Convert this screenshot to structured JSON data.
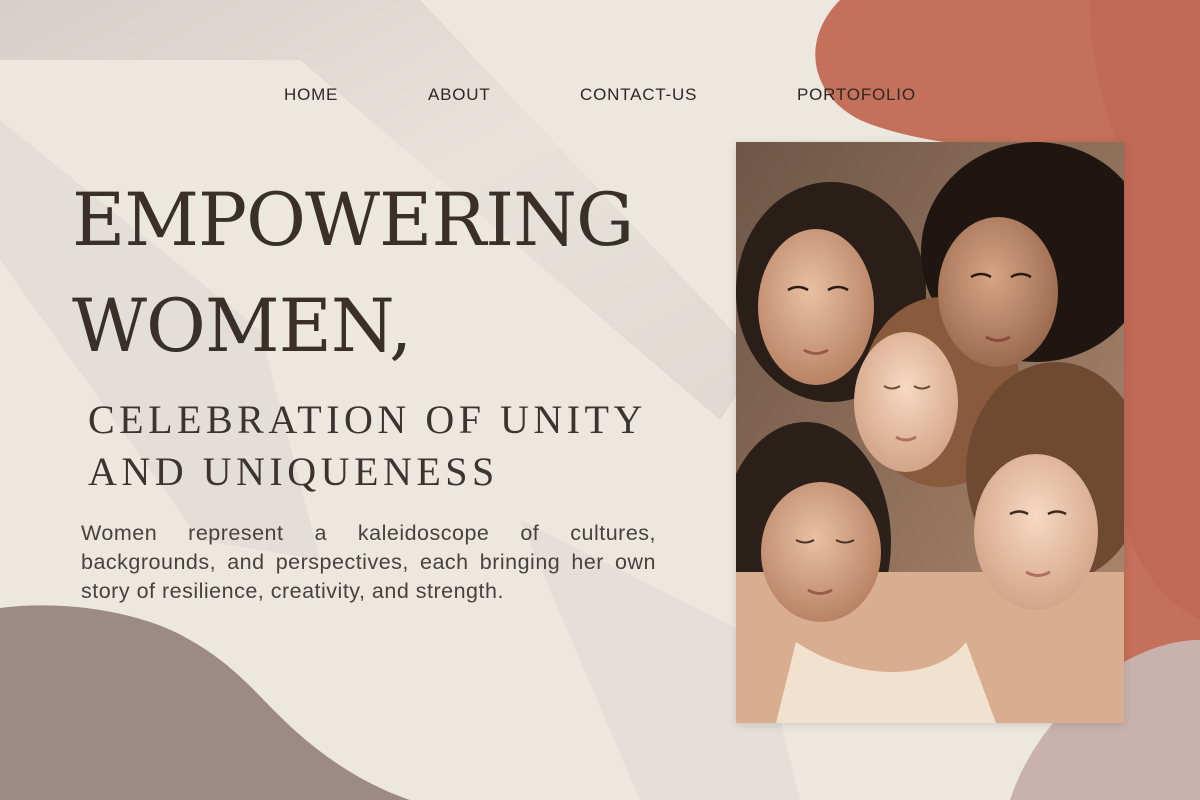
{
  "nav": {
    "items": [
      {
        "label": "HOME"
      },
      {
        "label": "ABOUT"
      },
      {
        "label": "CONTACT-US"
      },
      {
        "label": "PORTOFOLIO"
      }
    ]
  },
  "hero": {
    "headline_line1": "EMPOWERING",
    "headline_line2": "WOMEN,",
    "subheading_line1": "CELEBRATION OF UNITY",
    "subheading_line2": "AND UNIQUENESS",
    "body": "Women represent a kaleidoscope of cultures, backgrounds, and perspectives, each bringing her own story of resilience, creativity, and strength."
  },
  "colors": {
    "background": "#ece7df",
    "terracotta": "#c4705a",
    "mauve": "#a08b86",
    "text_dark": "#3a2f29"
  }
}
